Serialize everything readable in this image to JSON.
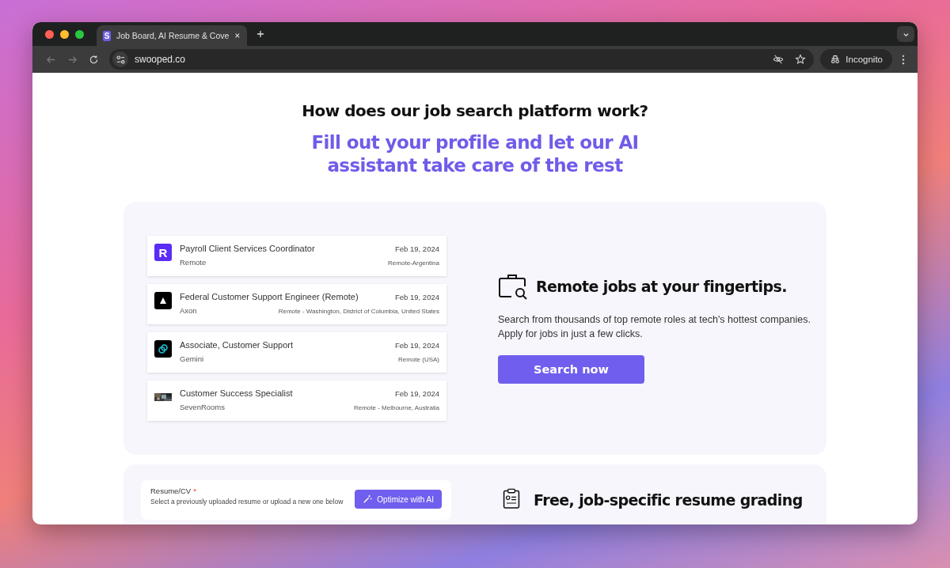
{
  "browser": {
    "tab": {
      "favicon": "S",
      "title": "Job Board, AI Resume & Cove",
      "selected": true
    },
    "address": "swooped.co",
    "profile": "Incognito"
  },
  "page": {
    "heading": "How does our job search platform work?",
    "subheading": "Fill out your profile and let our AI assistant take care of the rest",
    "feature": {
      "jobs": [
        {
          "title": "Payroll Client Services Coordinator",
          "company": "Remote",
          "date": "Feb 19, 2024",
          "location": "Remote-Argentina",
          "logo": {
            "kind": "letter",
            "text": "R"
          }
        },
        {
          "title": "Federal Customer Support Engineer (Remote)",
          "company": "Axon",
          "date": "Feb 19, 2024",
          "location": "Remote - Washington, District of Columbia, United States",
          "logo": {
            "kind": "triangle"
          }
        },
        {
          "title": "Associate, Customer Support",
          "company": "Gemini",
          "date": "Feb 19, 2024",
          "location": "Remote (USA)",
          "logo": {
            "kind": "rings"
          }
        },
        {
          "title": "Customer Success Specialist",
          "company": "SevenRooms",
          "date": "Feb 19, 2024",
          "location": "Remote - Melbourne, Australia"
        }
      ],
      "title": "Remote jobs at your fingertips.",
      "text": "Search from thousands of top remote roles at tech's hottest companies. Apply for jobs in just a few clicks.",
      "button": "Search now"
    },
    "feature_2": {
      "field_label": "Resume/CV",
      "required_mark": "*",
      "field_hint": "Select a previously uploaded resume or upload a new one below",
      "button": "Optimize with AI",
      "title": "Free, job-specific resume grading"
    }
  }
}
